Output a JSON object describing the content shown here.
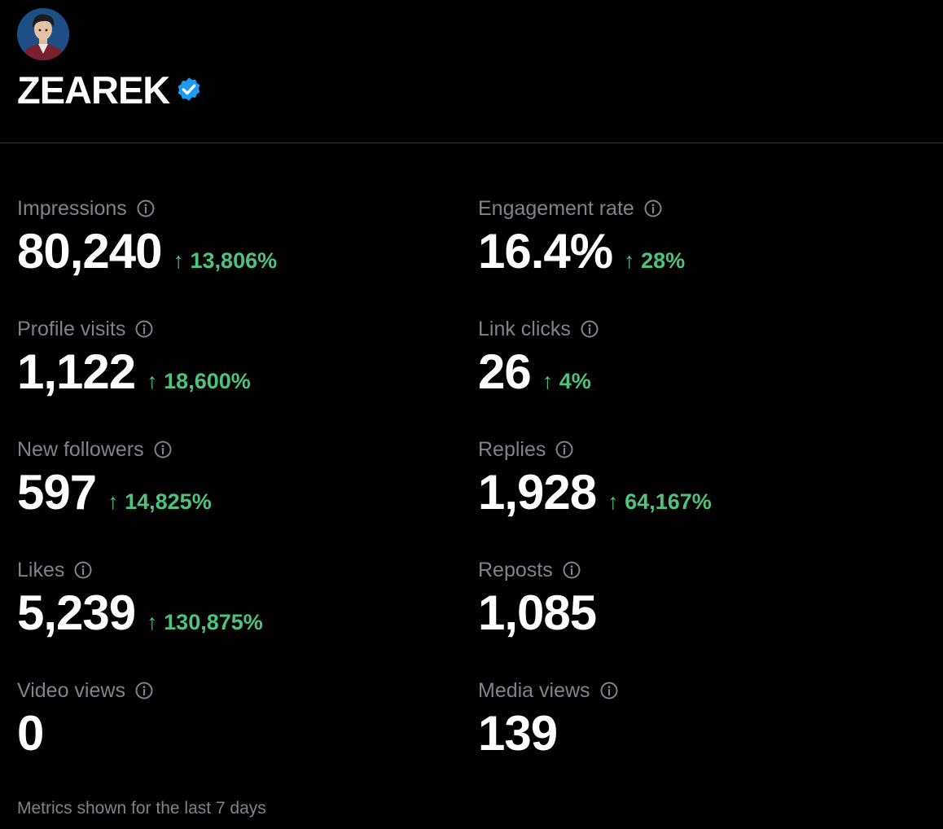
{
  "profile": {
    "display_name": "ZEAREK",
    "verified": true,
    "avatar_icon": "avatar-icon",
    "verified_color": "#1d9bf0"
  },
  "metrics": [
    {
      "label": "Impressions",
      "value": "80,240",
      "change": "↑ 13,806%"
    },
    {
      "label": "Engagement rate",
      "value": "16.4%",
      "change": "↑ 28%"
    },
    {
      "label": "Profile visits",
      "value": "1,122",
      "change": "↑ 18,600%"
    },
    {
      "label": "Link clicks",
      "value": "26",
      "change": "↑ 4%"
    },
    {
      "label": "New followers",
      "value": "597",
      "change": "↑ 14,825%"
    },
    {
      "label": "Replies",
      "value": "1,928",
      "change": "↑ 64,167%"
    },
    {
      "label": "Likes",
      "value": "5,239",
      "change": "↑ 130,875%"
    },
    {
      "label": "Reposts",
      "value": "1,085",
      "change": ""
    },
    {
      "label": "Video views",
      "value": "0",
      "change": ""
    },
    {
      "label": "Media views",
      "value": "139",
      "change": ""
    }
  ],
  "footer": {
    "note": "Metrics shown for the last 7 days"
  },
  "colors": {
    "background": "#000000",
    "label": "#808387",
    "value": "#ffffff",
    "positive_change": "#4fc27c",
    "divider": "#333639"
  }
}
